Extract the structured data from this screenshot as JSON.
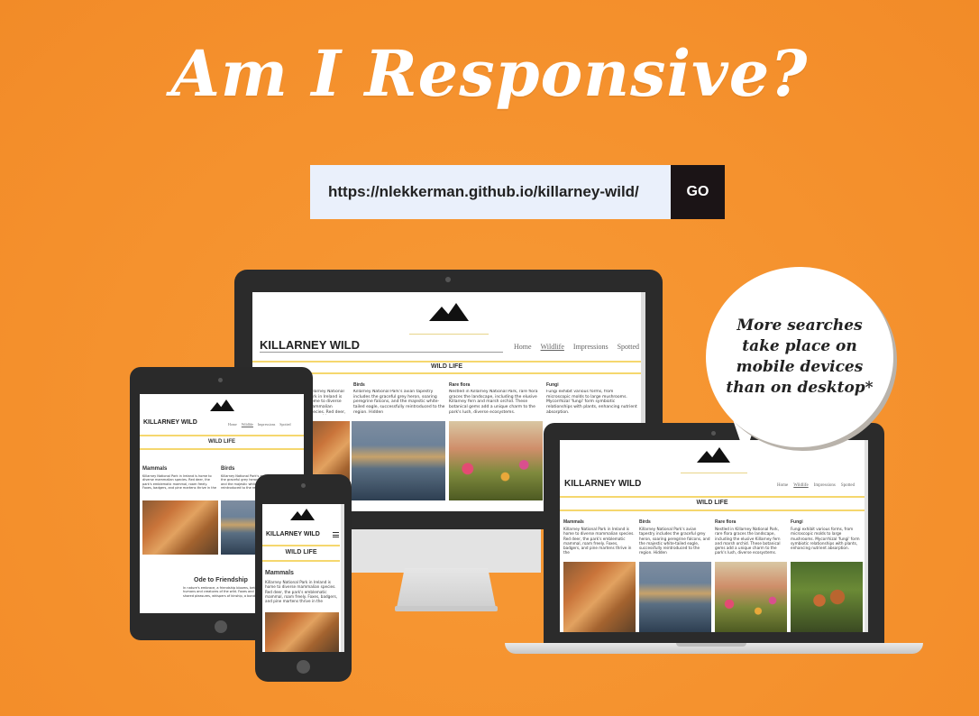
{
  "header": {
    "title": "Am I Responsive?"
  },
  "search": {
    "url_value": "https://nlekkerman.github.io/killarney-wild/",
    "go_label": "GO"
  },
  "bubble": {
    "text": "More searches take place on mobile devices than on desktop*"
  },
  "site": {
    "title": "KILLARNEY WILD",
    "nav": [
      "Home",
      "Wildlife",
      "Impressions",
      "Spotted"
    ],
    "section": "WILD LIFE",
    "columns": [
      {
        "head": "Mammals",
        "text": "Killarney National Park in Ireland is home to diverse mammalian species. Red deer, the park's emblematic mammal, roam freely. Foxes, badgers, and pine martens thrive in the"
      },
      {
        "head": "Birds",
        "text": "Killarney National Park's avian tapestry includes the graceful grey heron, soaring peregrine falcons, and the majestic white-tailed eagle, successfully reintroduced to the region. Hidden"
      },
      {
        "head": "Rare flora",
        "text": "Nestled in Killarney National Park, rare flora graces the landscape, including the elusive Killarney fern and marsh orchid. These botanical gems add a unique charm to the park's lush, diverse ecosystems."
      },
      {
        "head": "Fungi",
        "text": "Fungi exhibit various forms, from microscopic molds to large mushrooms. Mycorrhizal 'fungi' form symbiotic relationships with plants, enhancing nutrient absorption."
      }
    ],
    "ode_title": "Ode to Friendship",
    "ode_text": "In nature's embrace, a friendship blooms, between humans and creatures of the wild. Foxes and herons, shared pleasures, whispers of kinship, a bond unbound."
  },
  "colors": {
    "background": "#f5922e",
    "url_bg": "#eaf0fb",
    "go_bg": "#1b1416",
    "accent_line": "#f5d76e"
  }
}
